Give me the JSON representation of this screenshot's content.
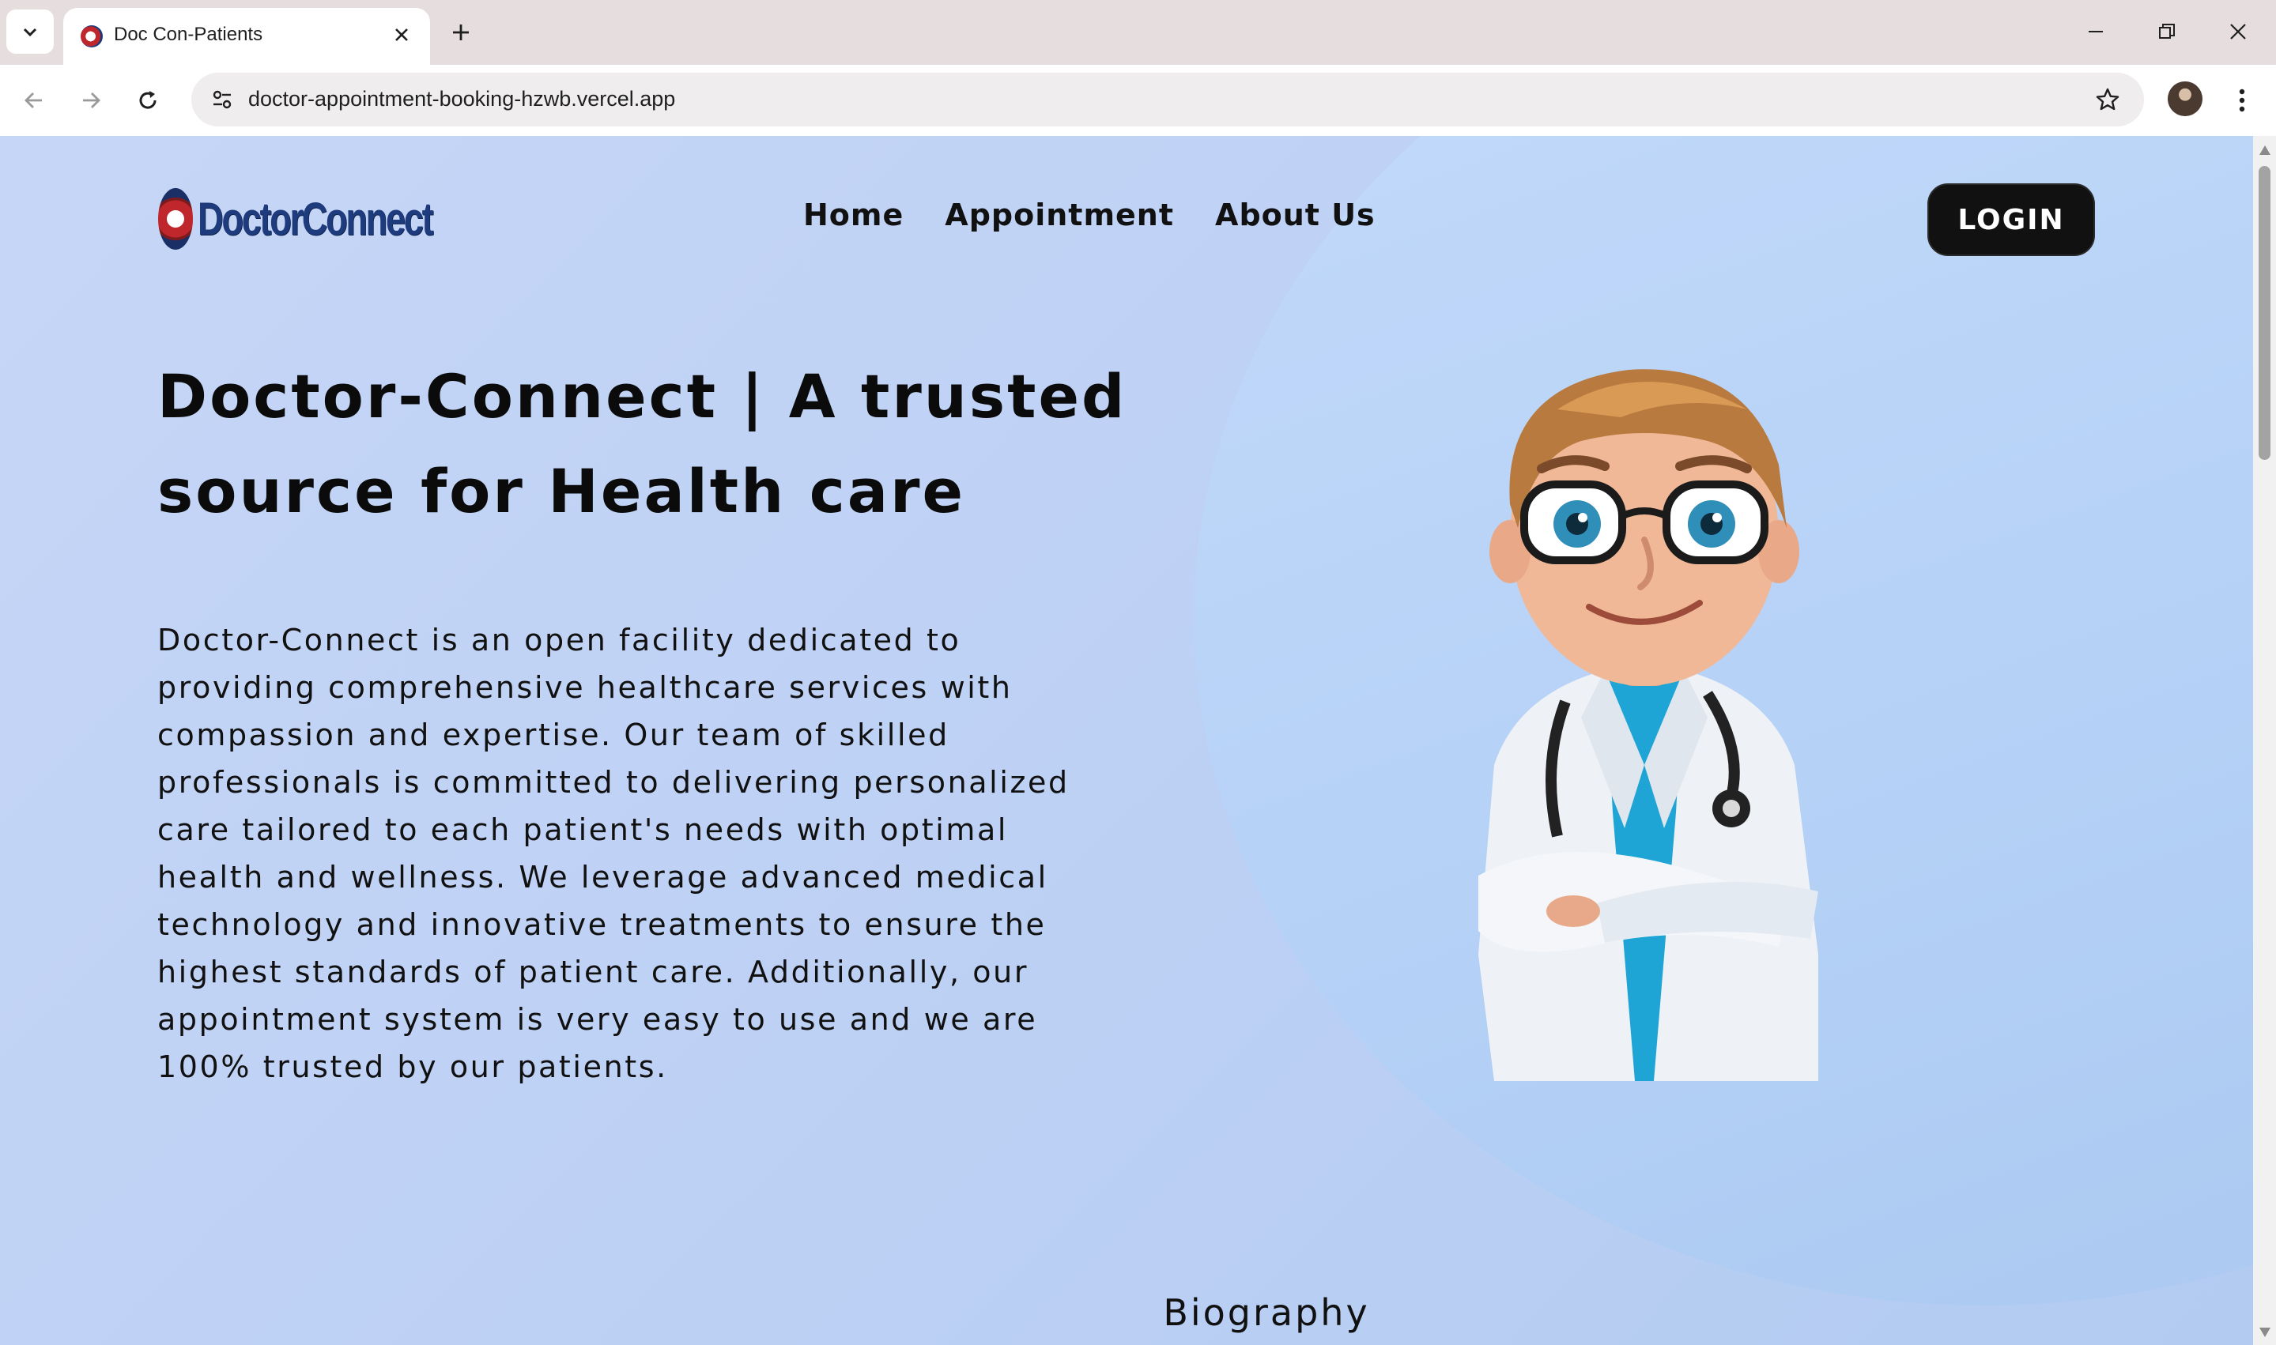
{
  "browser": {
    "tab_title": "Doc Con-Patients",
    "url": "doctor-appointment-booking-hzwb.vercel.app",
    "icons": {
      "tab_search": "chevron-down-icon",
      "close": "close-icon",
      "new_tab": "plus-icon",
      "back": "arrow-left-icon",
      "forward": "arrow-right-icon",
      "reload": "reload-icon",
      "site_info": "tune-icon",
      "bookmark": "star-icon",
      "menu": "more-vert-icon"
    }
  },
  "site": {
    "logo_text": "DoctorConnect",
    "nav": {
      "home": "Home",
      "appointment": "Appointment",
      "about": "About Us"
    },
    "login_label": "LOGIN"
  },
  "hero": {
    "title": "Doctor-Connect | A trusted source for Health care",
    "description": "Doctor-Connect is an open facility dedicated to providing comprehensive healthcare services with compassion and expertise. Our team of skilled professionals is committed to delivering personalized care tailored to each patient's needs with optimal health and wellness. We leverage advanced medical technology and innovative treatments to ensure the highest standards of patient care. Additionally, our appointment system is very easy to use and we are 100% trusted by our patients."
  },
  "biography": {
    "heading": "Biography"
  },
  "colors": {
    "page_background": "#c6d6f6",
    "login_button": "#111111",
    "logo_blue": "#1e3c7d",
    "logo_red": "#c0272d"
  }
}
